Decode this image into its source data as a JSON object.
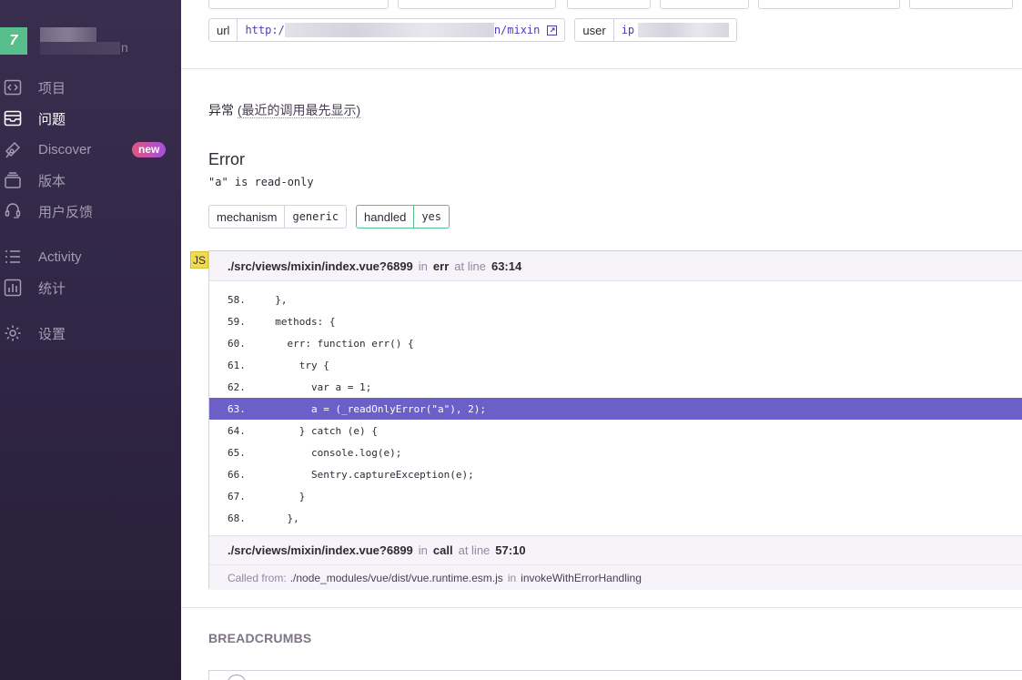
{
  "sidebar": {
    "org_initial": "7",
    "org_name_tail": "n",
    "items": [
      {
        "label": "项目",
        "icon": "code-icon",
        "active": false
      },
      {
        "label": "问题",
        "icon": "inbox-icon",
        "active": true
      },
      {
        "label": "Discover",
        "icon": "telescope-icon",
        "active": false,
        "badge": "new"
      },
      {
        "label": "版本",
        "icon": "layers-icon",
        "active": false
      },
      {
        "label": "用户反馈",
        "icon": "support-icon",
        "active": false
      },
      {
        "label": "Activity",
        "icon": "list-icon",
        "active": false
      },
      {
        "label": "统计",
        "icon": "bar-chart-icon",
        "active": false
      },
      {
        "label": "设置",
        "icon": "gear-icon",
        "active": false
      }
    ]
  },
  "tags": {
    "url": {
      "key": "url",
      "value_start": "http:/",
      "value_end": "n/mixin"
    },
    "user": {
      "key": "user",
      "value_start": "ip"
    }
  },
  "exception": {
    "section_label": "异常",
    "section_note": "(最近的调用最先显示)",
    "type": "Error",
    "message": "\"a\" is read-only",
    "mechanism": {
      "key": "mechanism",
      "value": "generic"
    },
    "handled": {
      "key": "handled",
      "value": "yes"
    }
  },
  "stack": {
    "platform": "JS",
    "frames": [
      {
        "file": "./src/views/mixin/index.vue?6899",
        "in_label": "in",
        "function": "err",
        "at_label": "at line",
        "position": "63:14"
      },
      {
        "file": "./src/views/mixin/index.vue?6899",
        "in_label": "in",
        "function": "call",
        "at_label": "at line",
        "position": "57:10"
      }
    ],
    "code": [
      {
        "ln": "58.",
        "src": "  },"
      },
      {
        "ln": "59.",
        "src": "  methods: {"
      },
      {
        "ln": "60.",
        "src": "    err: function err() {"
      },
      {
        "ln": "61.",
        "src": "      try {"
      },
      {
        "ln": "62.",
        "src": "        var a = 1;"
      },
      {
        "ln": "63.",
        "src": "        a = (_readOnlyError(\"a\"), 2);"
      },
      {
        "ln": "64.",
        "src": "      } catch (e) {"
      },
      {
        "ln": "65.",
        "src": "        console.log(e);"
      },
      {
        "ln": "66.",
        "src": "        Sentry.captureException(e);"
      },
      {
        "ln": "67.",
        "src": "      }"
      },
      {
        "ln": "68.",
        "src": "    },"
      }
    ],
    "active_line": "63.",
    "called_from_label": "Called from:",
    "called_from_path": "./node_modules/vue/dist/vue.runtime.esm.js",
    "called_from_in": "in",
    "called_from_fn": "invokeWithErrorHandling"
  },
  "breadcrumbs": {
    "title": "BREADCRUMBS"
  },
  "colors": {
    "accent": "#6c5fc7",
    "sidebar": "#2f2544",
    "success": "#57be8c",
    "js_badge": "#f0db4f"
  }
}
